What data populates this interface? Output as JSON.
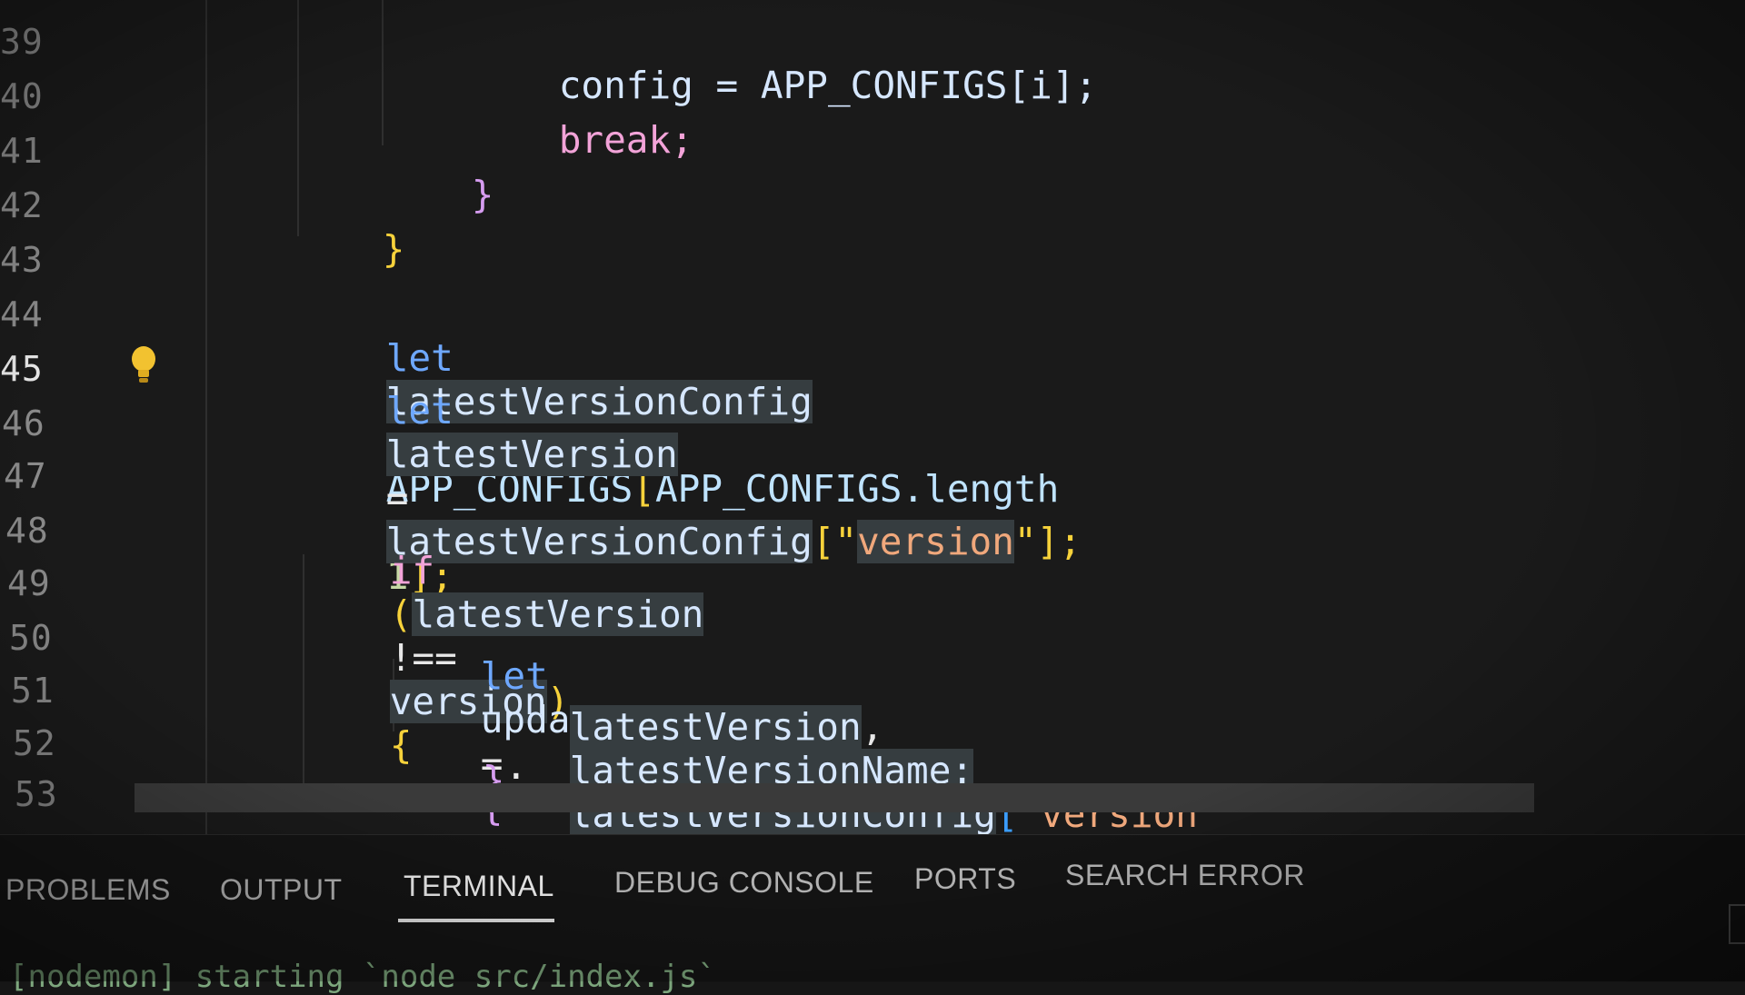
{
  "editor": {
    "line_numbers": [
      "39",
      "40",
      "41",
      "42",
      "43",
      "44",
      "45",
      "46",
      "47",
      "48",
      "49",
      "50",
      "51",
      "52",
      "53"
    ],
    "active_line": "45",
    "lines": {
      "l39": "config = APP_CONFIGS[i];",
      "l40": "break;",
      "l41": "}",
      "l42": "}",
      "l44": {
        "kw": "let",
        "var": "latestVersionConfig",
        "eq": "=",
        "const": "APP_CONFIGS",
        "open": "[",
        "inner": "APP_CONFIGS.length",
        "minus": "-",
        "num": "1",
        "close": "];"
      },
      "l45": {
        "kw": "let",
        "var": "latestVersion",
        "eq": "=",
        "obj": "latestVersionConfig",
        "open": "[\"",
        "key": "version",
        "close": "\"];"
      },
      "l48": {
        "kw": "if",
        "open": "(",
        "a": "latestVersion",
        "op": "!==",
        "b": "version",
        "close": ")",
        "brace": "{"
      },
      "l50": {
        "kw": "let",
        "var": "updateData",
        "eq": "=",
        "brace": "{"
      },
      "l51": {
        "a": "latestVersion",
        "comma": ",",
        "b": "latestVersionName:",
        "c": "latestVersionConfig",
        "open": "[\"",
        "key": "version"
      },
      "l52": {
        "brace": "}",
        "semi": ";"
      }
    }
  },
  "panel": {
    "tabs": [
      "PROBLEMS",
      "OUTPUT",
      "TERMINAL",
      "DEBUG CONSOLE",
      "PORTS",
      "SEARCH ERROR"
    ],
    "active_tab": "TERMINAL",
    "terminal_line": "[nodemon] starting `node src/index.js`"
  },
  "colors": {
    "keyword": "#6ea8ff",
    "flow": "#f2a3d8",
    "string": "#f0a87c",
    "brace_yellow": "#f7d23b",
    "brace_purple": "#d69cf0",
    "brace_blue": "#3b9dff"
  },
  "icons": {
    "lightbulb": "lightbulb-icon"
  }
}
